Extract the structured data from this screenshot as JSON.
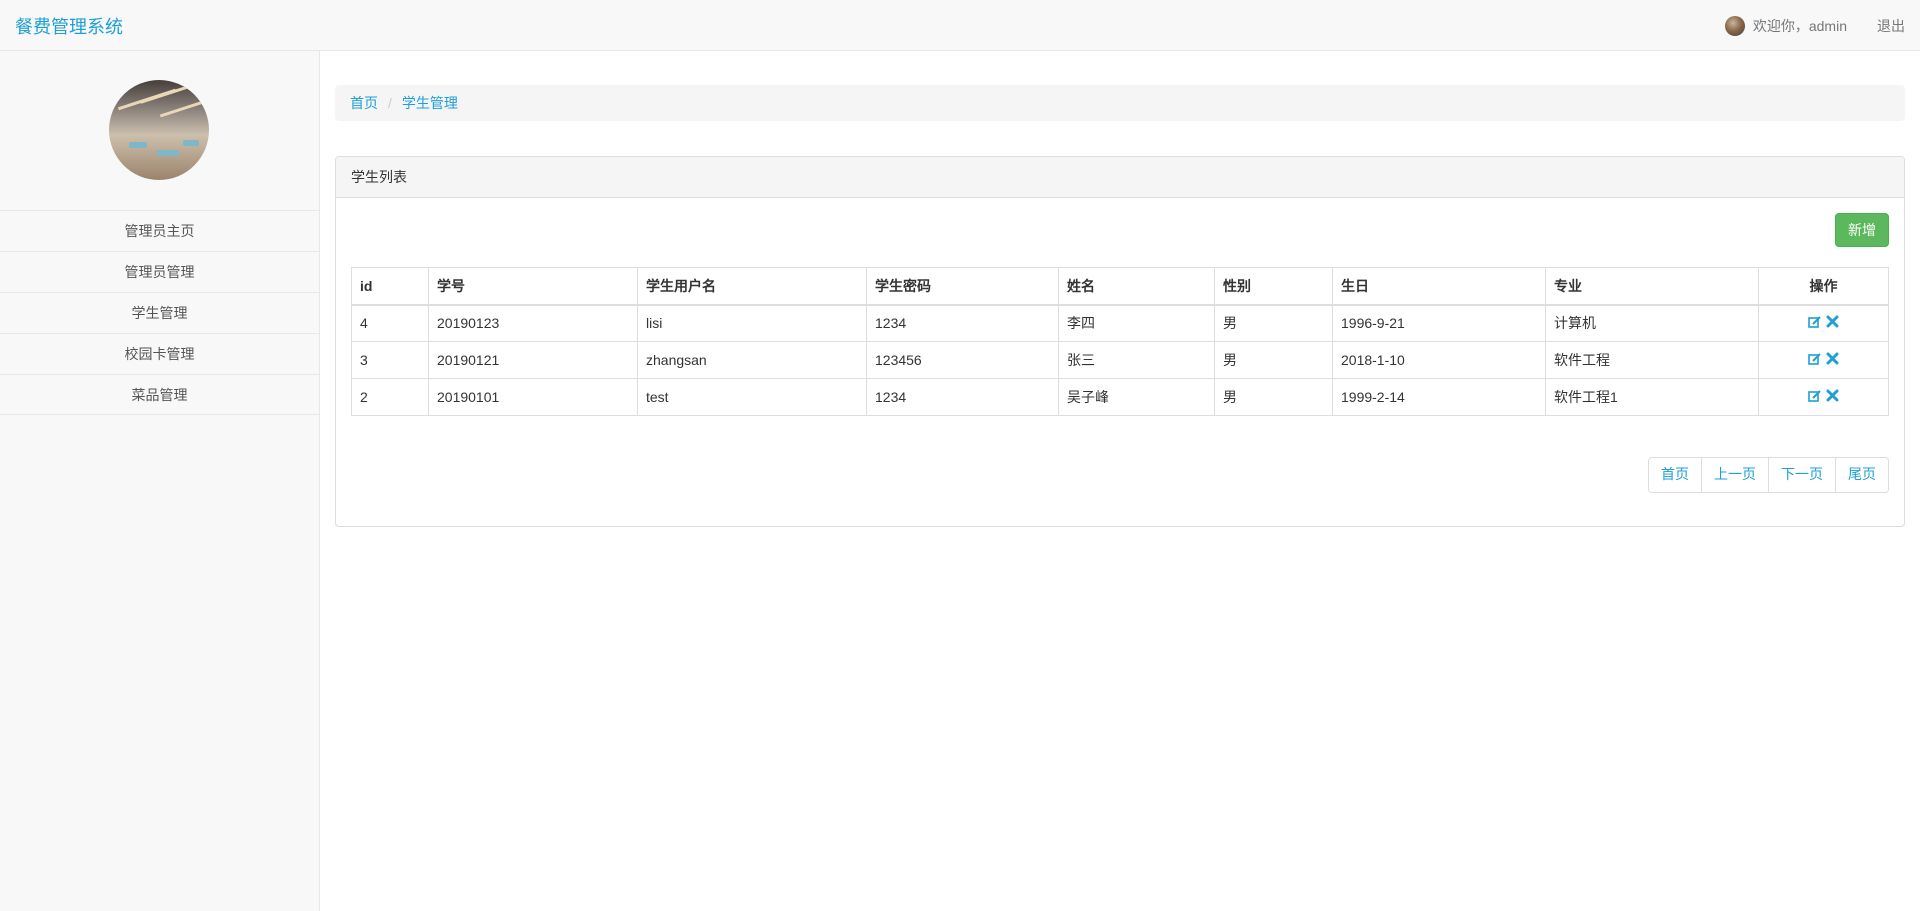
{
  "app": {
    "title": "餐费管理系统"
  },
  "header": {
    "welcome": "欢迎你，admin",
    "logout": "退出"
  },
  "sidebar": {
    "items": [
      {
        "label": "管理员主页"
      },
      {
        "label": "管理员管理"
      },
      {
        "label": "学生管理"
      },
      {
        "label": "校园卡管理"
      },
      {
        "label": "菜品管理"
      }
    ]
  },
  "breadcrumb": {
    "home": "首页",
    "current": "学生管理"
  },
  "panel": {
    "title": "学生列表",
    "add_label": "新增"
  },
  "table": {
    "headers": [
      "id",
      "学号",
      "学生用户名",
      "学生密码",
      "姓名",
      "性别",
      "生日",
      "专业",
      "操作"
    ],
    "rows": [
      [
        "4",
        "20190123",
        "lisi",
        "1234",
        "李四",
        "男",
        "1996-9-21",
        "计算机"
      ],
      [
        "3",
        "20190121",
        "zhangsan",
        "123456",
        "张三",
        "男",
        "2018-1-10",
        "软件工程"
      ],
      [
        "2",
        "20190101",
        "test",
        "1234",
        "吴子峰",
        "男",
        "1999-2-14",
        "软件工程1"
      ]
    ]
  },
  "pagination": {
    "first": "首页",
    "prev": "上一页",
    "next": "下一页",
    "last": "尾页"
  },
  "colors": {
    "accent": "#1e9fd6",
    "success": "#5cb85c"
  }
}
